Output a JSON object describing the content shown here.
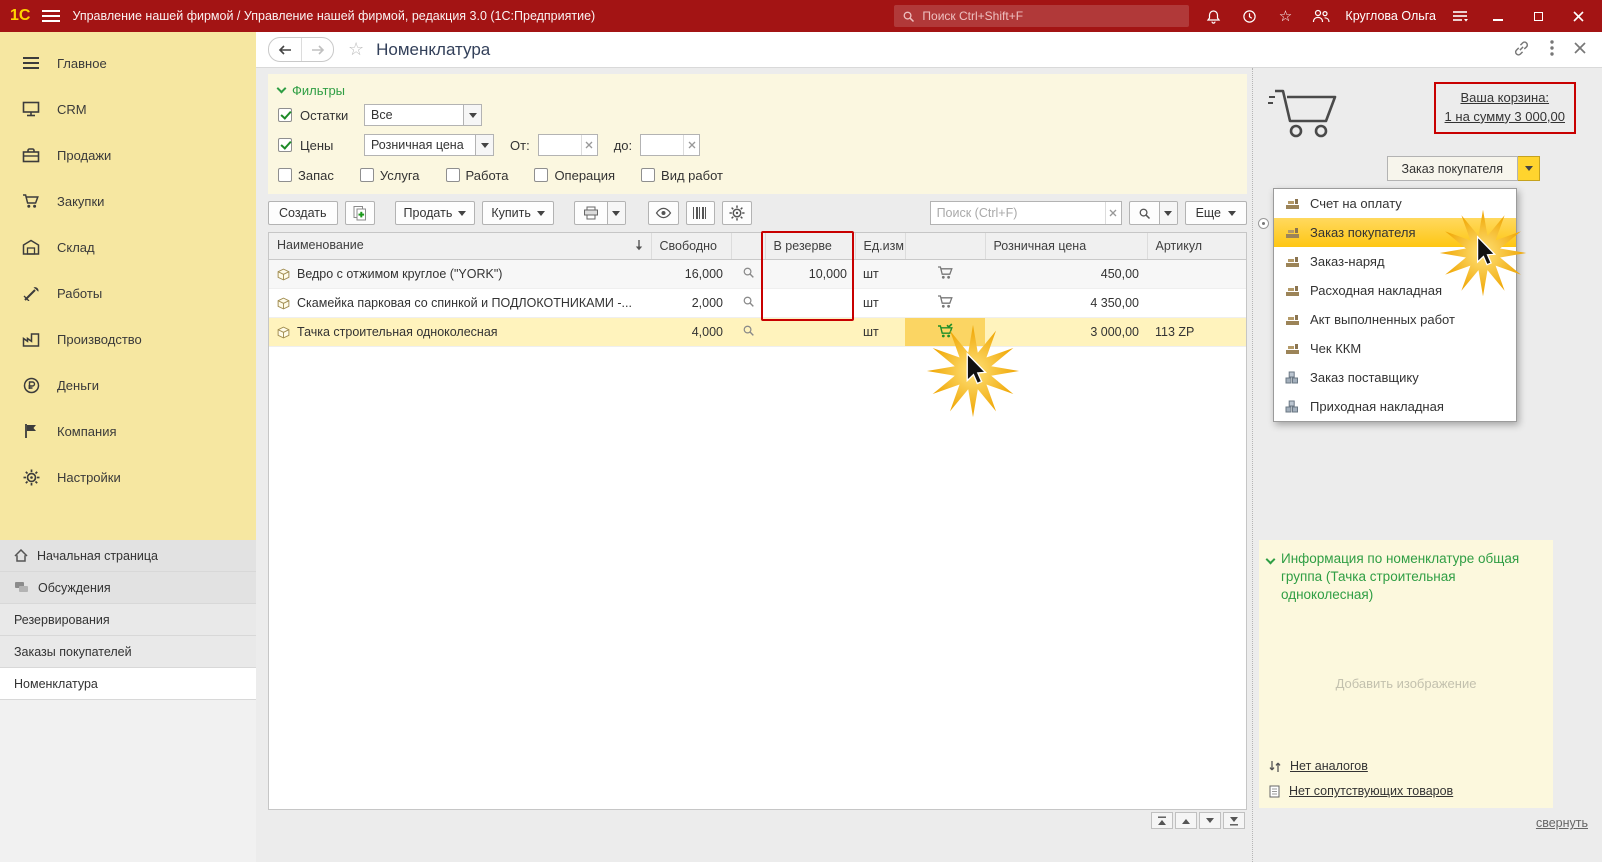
{
  "titlebar": {
    "logo": "1С",
    "title": "Управление нашей фирмой / Управление нашей фирмой, редакция 3.0  (1С:Предприятие)",
    "search_placeholder": "Поиск Ctrl+Shift+F",
    "user": "Круглова Ольга"
  },
  "sidebar": {
    "items": [
      {
        "label": "Главное"
      },
      {
        "label": "CRM"
      },
      {
        "label": "Продажи"
      },
      {
        "label": "Закупки"
      },
      {
        "label": "Склад"
      },
      {
        "label": "Работы"
      },
      {
        "label": "Производство"
      },
      {
        "label": "Деньги"
      },
      {
        "label": "Компания"
      },
      {
        "label": "Настройки"
      }
    ],
    "bottom_items": [
      {
        "label": "Начальная страница"
      },
      {
        "label": "Обсуждения"
      },
      {
        "label": "Резервирования"
      },
      {
        "label": "Заказы покупателей"
      },
      {
        "label": "Номенклатура"
      }
    ]
  },
  "header": {
    "title": "Номенклатура"
  },
  "filters": {
    "title": "Фильтры",
    "stock": {
      "label": "Остатки",
      "value": "Все"
    },
    "price": {
      "label": "Цены",
      "value": "Розничная цена",
      "from_label": "От:",
      "to_label": "до:"
    },
    "type_checkboxes": [
      "Запас",
      "Услуга",
      "Работа",
      "Операция",
      "Вид работ"
    ]
  },
  "toolbar": {
    "create": "Создать",
    "sell": "Продать",
    "buy": "Купить",
    "search_placeholder": "Поиск (Ctrl+F)",
    "more": "Еще"
  },
  "table": {
    "columns": {
      "name": "Наименование",
      "free": "Свободно",
      "reserve": "В резерве",
      "unit": "Ед.изм",
      "price": "Розничная цена",
      "article": "Артикул"
    },
    "rows": [
      {
        "name": "Ведро с отжимом  круглое (\"YORK\")",
        "free": "16,000",
        "reserve": "10,000",
        "unit": "шт",
        "price": "450,00",
        "article": ""
      },
      {
        "name": "Скамейка парковая со спинкой и ПОДЛОКОТНИКАМИ -...",
        "free": "2,000",
        "reserve": "",
        "unit": "шт",
        "price": "4 350,00",
        "article": ""
      },
      {
        "name": "Тачка строительная одноколесная",
        "free": "4,000",
        "reserve": "",
        "unit": "шт",
        "price": "3 000,00",
        "article": "113 ZP"
      }
    ]
  },
  "cart_panel": {
    "cart_line1": "Ваша корзина:",
    "cart_line2": "1 на сумму 3 000,00",
    "order_button": "Заказ покупателя",
    "menu": [
      {
        "label": "Счет на оплату"
      },
      {
        "label": "Заказ покупателя"
      },
      {
        "label": "Заказ-наряд"
      },
      {
        "label": "Расходная накладная"
      },
      {
        "label": "Акт выполненных работ"
      },
      {
        "label": "Чек ККМ"
      },
      {
        "label": "Заказ поставщику"
      },
      {
        "label": "Приходная накладная"
      }
    ]
  },
  "info_panel": {
    "title": "Информация по номенклатуре общая группа (Тачка строительная одноколесная)",
    "add_image": "Добавить изображение",
    "no_analogs": "Нет аналогов",
    "no_related": "Нет сопутствующих товаров",
    "collapse": "свернуть"
  }
}
